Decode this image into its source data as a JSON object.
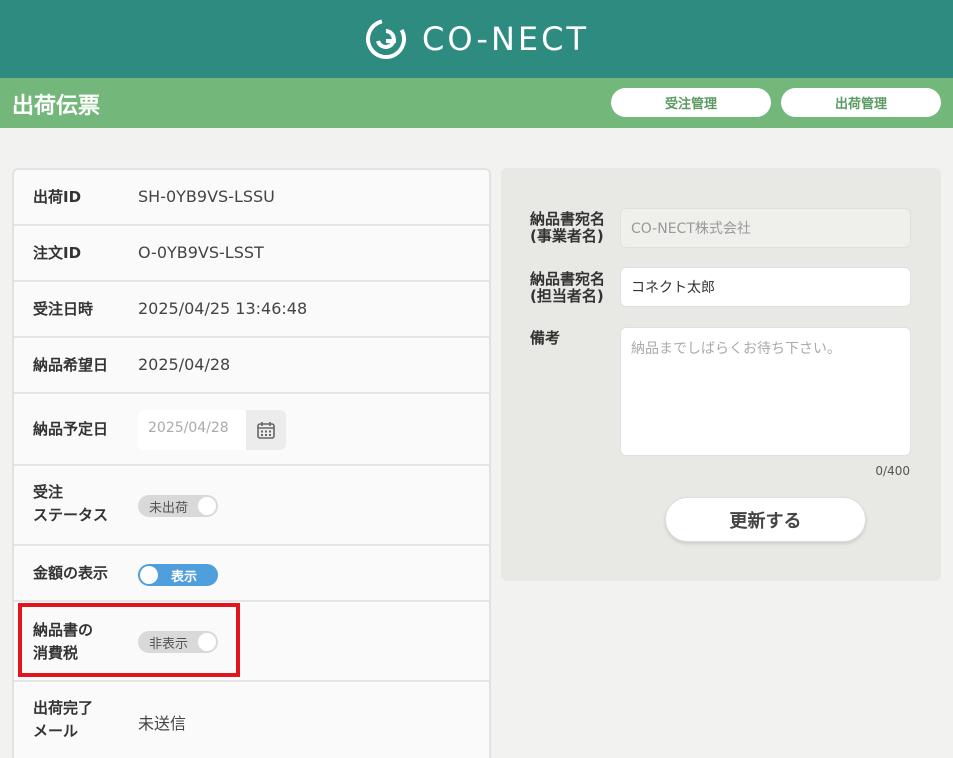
{
  "brand": {
    "name": "CO-NECT"
  },
  "header": {
    "title": "出荷伝票",
    "nav": {
      "order_mgmt": "受注管理",
      "shipping_mgmt": "出荷管理"
    }
  },
  "details": {
    "shipping_id": {
      "label": "出荷ID",
      "value": "SH-0YB9VS-LSSU"
    },
    "order_id": {
      "label": "注文ID",
      "value": "O-0YB9VS-LSST"
    },
    "order_datetime": {
      "label": "受注日時",
      "value": "2025/04/25 13:46:48"
    },
    "desired_date": {
      "label": "納品希望日",
      "value": "2025/04/28"
    },
    "scheduled_date": {
      "label": "納品予定日",
      "value": "2025/04/28"
    },
    "order_status": {
      "label_line1": "受注",
      "label_line2": "ステータス",
      "toggle_label": "未出荷",
      "checked": false
    },
    "price_display": {
      "label": "金額の表示",
      "toggle_label": "表示",
      "checked": true
    },
    "invoice_tax": {
      "label_line1": "納品書の",
      "label_line2": "消費税",
      "toggle_label": "非表示",
      "checked": false
    },
    "shipping_mail": {
      "label_line1": "出荷完了",
      "label_line2": "メール",
      "value": "未送信"
    }
  },
  "form": {
    "company": {
      "label_line1": "納品書宛名",
      "label_line2": "(事業者名)",
      "value": "CO-NECT株式会社"
    },
    "person": {
      "label_line1": "納品書宛名",
      "label_line2": "(担当者名)",
      "value": "コネクト太郎"
    },
    "remarks": {
      "label": "備考",
      "placeholder": "納品までしばらくお待ち下さい。",
      "counter": "0/400"
    },
    "submit_label": "更新する"
  },
  "colors": {
    "header_teal": "#2e8b80",
    "subbar_green": "#73b77b",
    "toggle_on_blue": "#4f9fdc",
    "highlight_red": "#e1161d"
  },
  "icons": {
    "logo": "co-nect-logo-icon",
    "calendar": "calendar-icon"
  }
}
